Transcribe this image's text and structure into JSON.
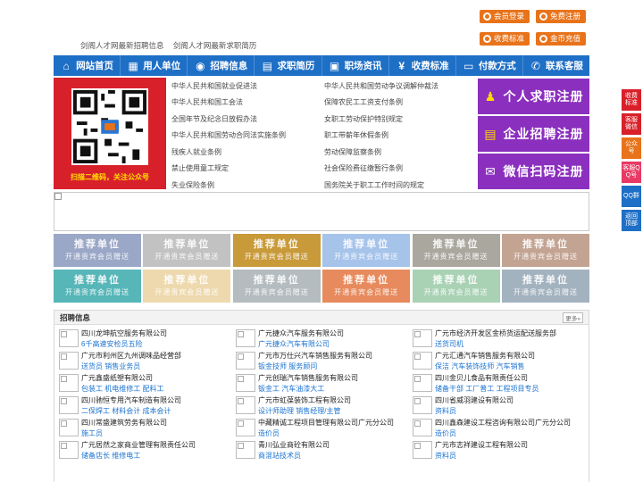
{
  "header": {
    "links": [
      "剑阁人才网最新招聘信息",
      "剑阁人才网最新求职简历"
    ],
    "buttons": [
      {
        "label": "会员登录",
        "icon": "user-icon"
      },
      {
        "label": "免费注册",
        "icon": "register-icon"
      },
      {
        "label": "收费标准",
        "icon": "price-icon"
      },
      {
        "label": "金币充值",
        "icon": "coin-icon"
      }
    ]
  },
  "nav": [
    {
      "label": "网站首页",
      "icon": "home-icon"
    },
    {
      "label": "用人单位",
      "icon": "building-icon"
    },
    {
      "label": "招聘信息",
      "icon": "megaphone-icon"
    },
    {
      "label": "求职简历",
      "icon": "resume-icon"
    },
    {
      "label": "职场资讯",
      "icon": "news-icon"
    },
    {
      "label": "收费标准",
      "icon": "price-icon"
    },
    {
      "label": "付款方式",
      "icon": "payment-icon"
    },
    {
      "label": "联系客服",
      "icon": "phone-icon"
    }
  ],
  "qr": {
    "caption": "扫描二维码，关注公众号"
  },
  "laws": [
    [
      "中华人民共和国就业促进法",
      "中华人民共和国劳动争议调解仲裁法"
    ],
    [
      "中华人民共和国工会法",
      "保障农民工工资支付条例"
    ],
    [
      "全国年节及纪念日放假办法",
      "女职工劳动保护特别规定"
    ],
    [
      "中华人民共和国劳动合同法实施条例",
      "职工带薪年休假条例"
    ],
    [
      "残疾人就业条例",
      "劳动保障监察条例"
    ],
    [
      "禁止使用童工规定",
      "社会保险费征缴暂行条例"
    ],
    [
      "失业保险条例",
      "国务院关于职工工作时间的规定"
    ]
  ],
  "register": [
    {
      "label": "个人求职注册",
      "icon": "person-icon"
    },
    {
      "label": "企业招聘注册",
      "icon": "company-icon"
    },
    {
      "label": "微信扫码注册",
      "icon": "wechat-icon"
    }
  ],
  "tiles": {
    "title": "推荐单位",
    "subtitle": "开通贵宾会员赠送",
    "colors": [
      "#9aa7c7",
      "#c2c2c2",
      "#c99a3a",
      "#a6c3ea",
      "#aaa79f",
      "#c3a392",
      "#56b6b8",
      "#eed9ae",
      "#b4bcbf",
      "#e78a5d",
      "#a9d2b4",
      "#a3b2bf"
    ]
  },
  "jobs": {
    "title": "招聘信息",
    "more": "更多»",
    "items": [
      {
        "company": "四川龙坤航空服务有限公司",
        "positions": "6千高速安检员五险"
      },
      {
        "company": "广元捷众汽车服务有限公司",
        "positions": "广元捷众汽车有限公司"
      },
      {
        "company": "广元市经济开发区金桥货运配送服务部",
        "positions": "送货司机"
      },
      {
        "company": "广元市利州区九州调味品经营部",
        "positions": "送货员 销售业务员"
      },
      {
        "company": "广元市万仕兴汽车销售服务有限公司",
        "positions": "钣金技师 服务顾问"
      },
      {
        "company": "广元汇通汽车销售服务有限公司",
        "positions": "保洁 汽车装饰技师 汽车销售"
      },
      {
        "company": "广元鑫盛纸塑有限公司",
        "positions": "包装工 机电维修工 配料工"
      },
      {
        "company": "广元创瑞汽车销售服务有限公司",
        "positions": "钣金工 汽车油漆大工"
      },
      {
        "company": "四川金贝儿食品有限责任公司",
        "positions": "储备干部 工厂普工 工程项目专员"
      },
      {
        "company": "四川驰恒专用汽车制造有限公司",
        "positions": "二保焊工 材料会计 成本会计"
      },
      {
        "company": "广元市虹葆装饰工程有限公司",
        "positions": "设计师助理 销售经理/主管"
      },
      {
        "company": "四川省威羽建设有限公司",
        "positions": "资料员"
      },
      {
        "company": "四川常盛建筑劳务有限公司",
        "positions": "施工员"
      },
      {
        "company": "中藏精诚工程项目管理有限公司广元分公司",
        "positions": "造价员"
      },
      {
        "company": "四川鑫森建设工程咨询有限公司广元分公司",
        "positions": "造价员"
      },
      {
        "company": "广元居然之家商业管理有限责任公司",
        "positions": "储备店长 维修电工"
      },
      {
        "company": "青川弘业商砼有限公司",
        "positions": "商混站技术员"
      },
      {
        "company": "广元市志祥建设工程有限公司",
        "positions": "资料员"
      }
    ]
  },
  "sidebar": [
    {
      "label": "收费标准",
      "color": "#d9202a"
    },
    {
      "label": "客服微信",
      "color": "#d9202a"
    },
    {
      "label": "公众号",
      "color": "#e8731a"
    },
    {
      "label": "客服QQ号",
      "color": "#e83a64"
    },
    {
      "label": "QQ群",
      "color": "#1e6fc6"
    },
    {
      "label": "返回顶部",
      "color": "#1e6fc6"
    }
  ]
}
